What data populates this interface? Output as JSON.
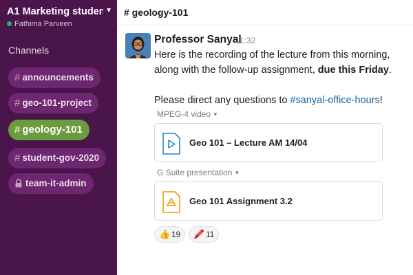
{
  "workspace": {
    "name": "A1 Marketing studen",
    "user": "Fathima Parveen"
  },
  "sidebar": {
    "section_title": "Channels",
    "channels": [
      {
        "label": "announcements"
      },
      {
        "label": "geo-101-project"
      },
      {
        "label": "geology-101"
      },
      {
        "label": "student-gov-2020"
      },
      {
        "label": "team-it-admin"
      }
    ]
  },
  "header": {
    "title": "# geology-101"
  },
  "message": {
    "author": "Professor Sanyal",
    "time": "11:32",
    "line1": "Here is the recording of the lecture from this morning,",
    "line2_prefix": "along with the follow-up assignment, ",
    "line2_bold": "due this Friday",
    "line2_suffix": ".",
    "line3_prefix": "Please direct any questions to ",
    "line3_link": "#sanyal-office-hours",
    "line3_suffix": "!"
  },
  "attachments": [
    {
      "type_label": "MPEG-4 video",
      "name": "Geo 101 – Lecture AM 14/04",
      "icon": "video-play-icon",
      "color": "#1e88d2"
    },
    {
      "type_label": "G Suite presentation",
      "name": "Geo 101 Assignment 3.2",
      "icon": "google-slides-icon",
      "color": "#f29900"
    }
  ],
  "reactions": [
    {
      "emoji": "👍",
      "count": "19"
    },
    {
      "emoji": "🖍️",
      "count": "11"
    }
  ],
  "colors": {
    "sidebar_bg": "#4a154b",
    "channel_pill": "#6f2671",
    "active_channel": "#6b9b3d",
    "link": "#1264a3",
    "presence": "#2bac76"
  }
}
